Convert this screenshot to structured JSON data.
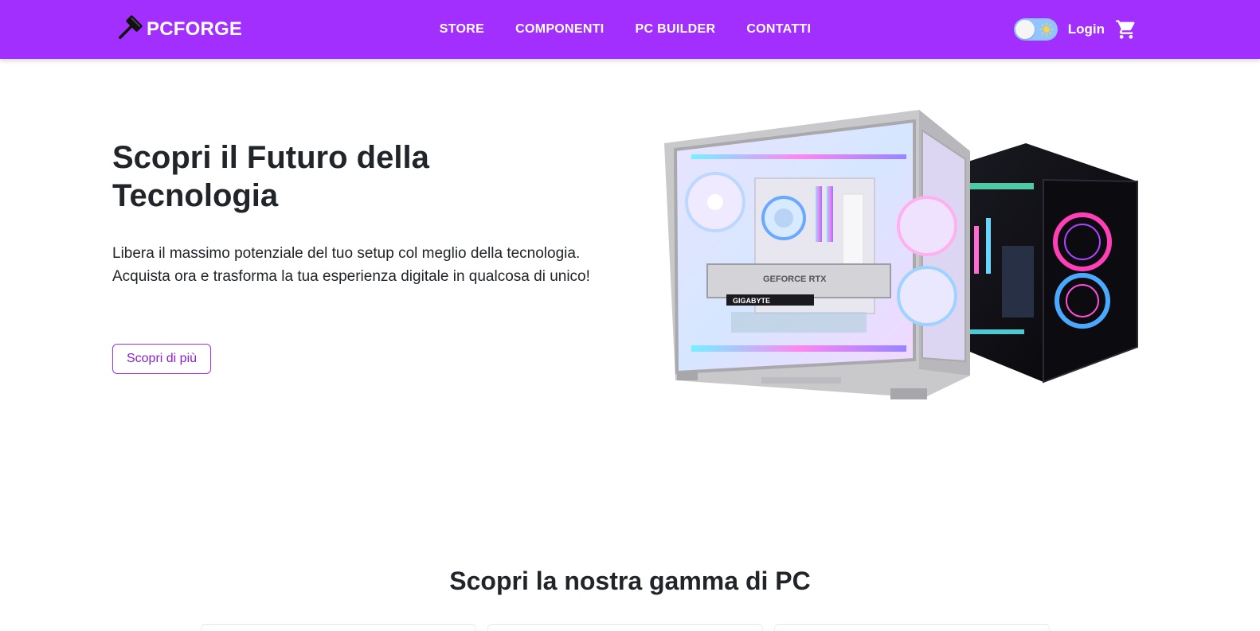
{
  "navbar": {
    "brand_name": "PCFORGE",
    "links": [
      "STORE",
      "COMPONENTI",
      "PC BUILDER",
      "CONTATTI"
    ],
    "login_label": "Login",
    "accent_color": "#a32ffe"
  },
  "icons": {
    "logo": "hammer-icon",
    "theme_toggle": "sun-icon",
    "cart": "cart-icon"
  },
  "hero": {
    "title": "Scopri il Futuro della Tecnologia",
    "description": "Libera il massimo potenziale del tuo setup col meglio della tecnologia. Acquista ora e trasforma la tua esperienza digitale in qualcosa di unico!",
    "cta_label": "Scopri di più",
    "image_labels": {
      "gpu_brand": "GIGABYTE",
      "gpu_model": "GEFORCE RTX"
    }
  },
  "products_section": {
    "title": "Scopri la nostra gamma di PC"
  }
}
